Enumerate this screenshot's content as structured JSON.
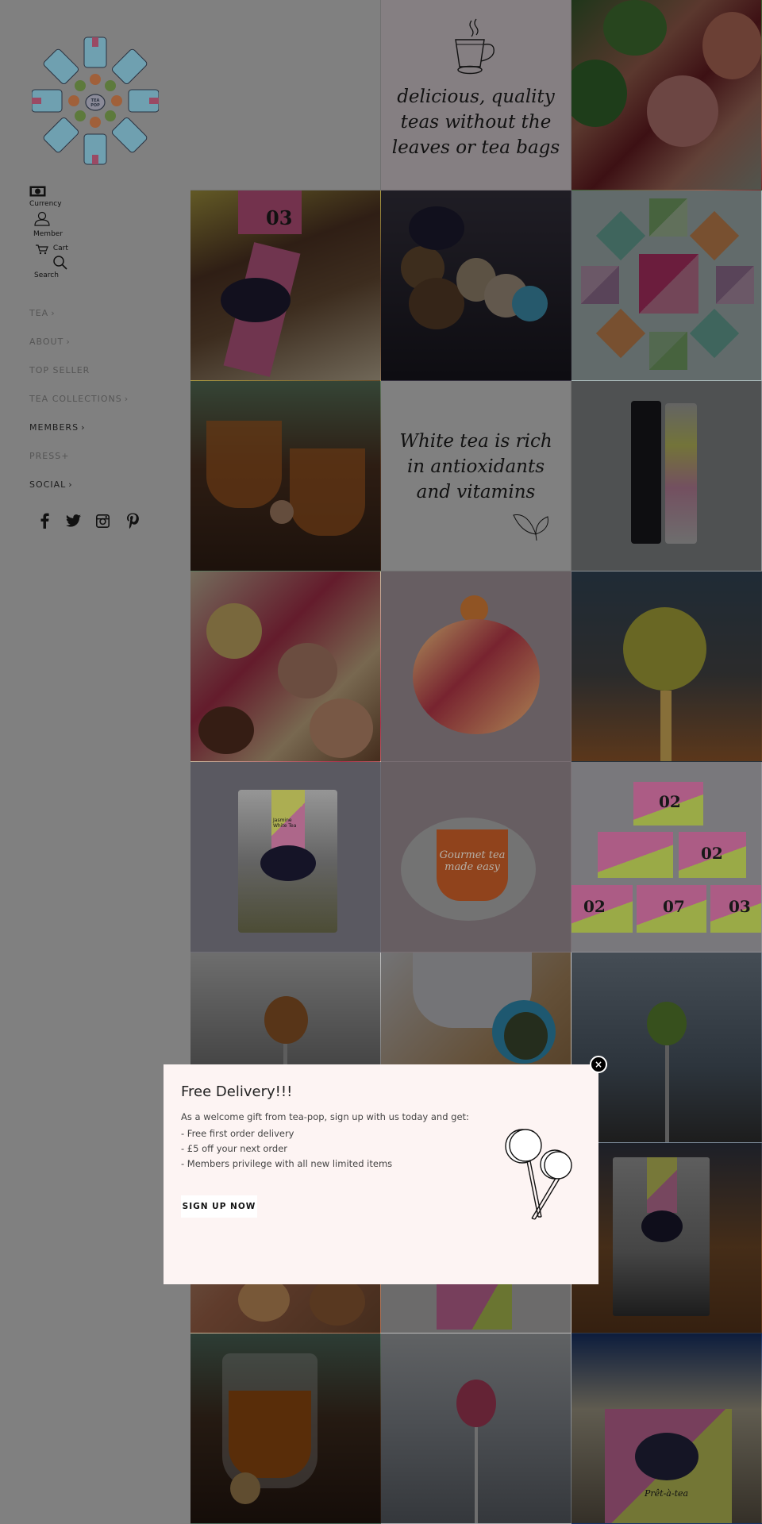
{
  "sidebar": {
    "logo_alt": "TEA POP",
    "utilities": {
      "currency": "Currency",
      "member": "Member",
      "cart": "Cart",
      "search": "Search"
    },
    "nav": [
      {
        "label": "TEA",
        "suffix": "›"
      },
      {
        "label": "ABOUT",
        "suffix": "›"
      },
      {
        "label": "TOP SELLER",
        "suffix": ""
      },
      {
        "label": "TEA COLLECTIONS",
        "suffix": "›"
      },
      {
        "label": "MEMBERS",
        "suffix": "›"
      },
      {
        "label": "PRESS",
        "suffix": "+"
      },
      {
        "label": "SOCIAL",
        "suffix": "›"
      }
    ],
    "social": [
      "facebook",
      "twitter",
      "instagram",
      "pinterest"
    ]
  },
  "grid": {
    "quote1": [
      "delicious, quality",
      "teas without the",
      "leaves or tea bags"
    ],
    "quote2": [
      "White tea is rich",
      "in antioxidants",
      "and vitamins"
    ],
    "tin_numbers": {
      "box": "03",
      "tin_a": "02",
      "tin_b": "02",
      "tin_c": "02",
      "tin_d": "07",
      "tin_e": "03"
    },
    "brand_badge": "TEA POP",
    "overlay_text": "Gourmet tea made easy",
    "bag_label": "Jasmine White Tea",
    "tin_caption": "Prêt-à-tea"
  },
  "popup": {
    "title": "Free Delivery!!!",
    "intro": "As a welcome gift from tea-pop, sign up with us today and get:",
    "benefits": [
      "- Free first order delivery",
      "- £5 off your next order",
      "- Members privilege with all new limited items"
    ],
    "cta": "SIGN UP NOW",
    "close": "×"
  },
  "colors": {
    "overlay": "#808080",
    "popup_bg": "#fdf4f3",
    "brand_pink": "#e86aa0",
    "brand_lime": "#d6e05a",
    "brand_navy": "#2b2a4a"
  }
}
